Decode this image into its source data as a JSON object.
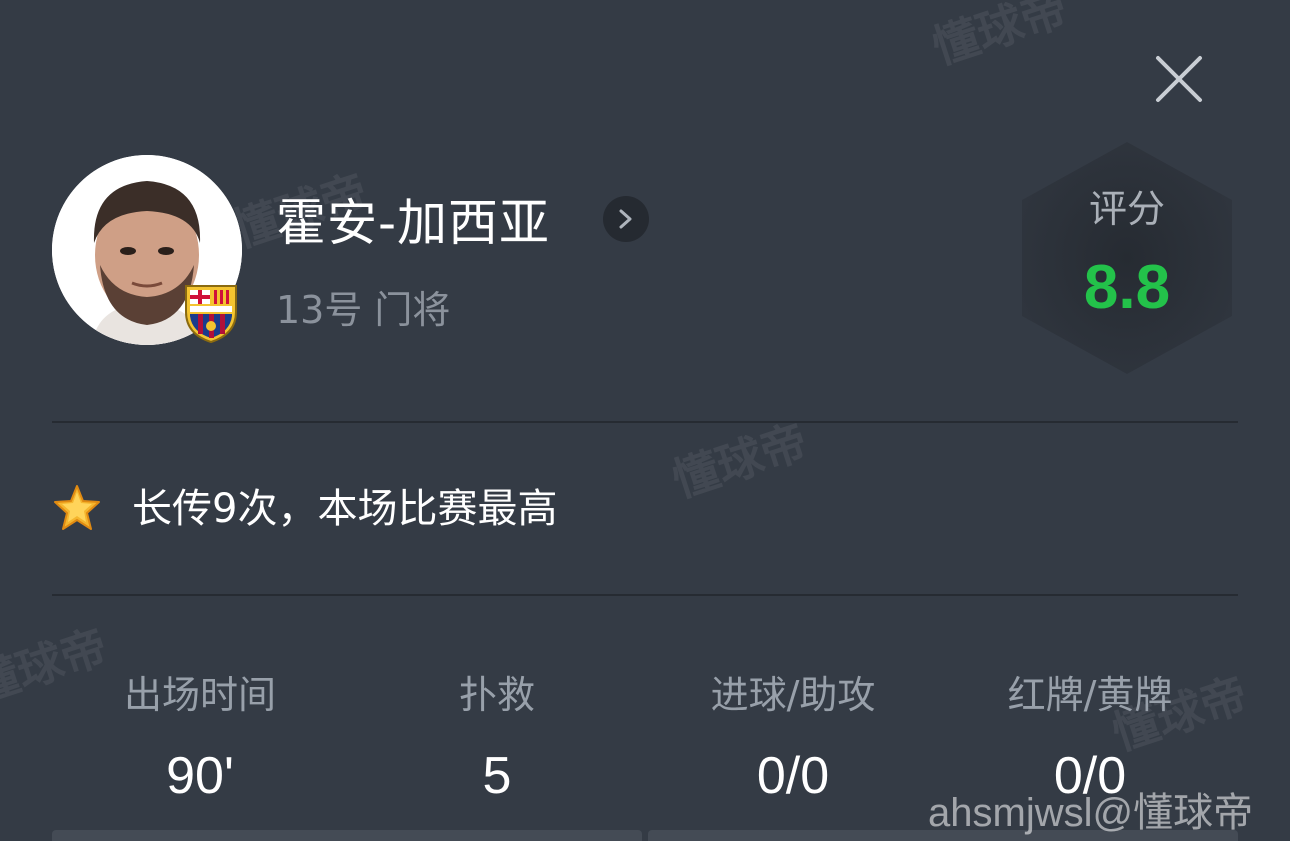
{
  "header": {
    "close_icon": "close-icon"
  },
  "player": {
    "name": "霍安-加西亚",
    "subtitle": "13号 门将",
    "club_badge_icon": "fcb-crest-icon",
    "avatar_icon": "player-avatar"
  },
  "rating": {
    "label": "评分",
    "value": "8.8",
    "value_color": "#23c24a"
  },
  "highlight": {
    "icon": "star-icon",
    "text": "长传9次，本场比赛最高"
  },
  "stats": [
    {
      "label": "出场时间",
      "value": "90'"
    },
    {
      "label": "扑救",
      "value": "5"
    },
    {
      "label": "进球/助攻",
      "value": "0/0"
    },
    {
      "label": "红牌/黄牌",
      "value": "0/0"
    }
  ],
  "watermark": {
    "text": "懂球帝",
    "credit": "ahsmjwsl@懂球帝"
  },
  "colors": {
    "background": "#343b45",
    "accent_green": "#23c24a"
  }
}
